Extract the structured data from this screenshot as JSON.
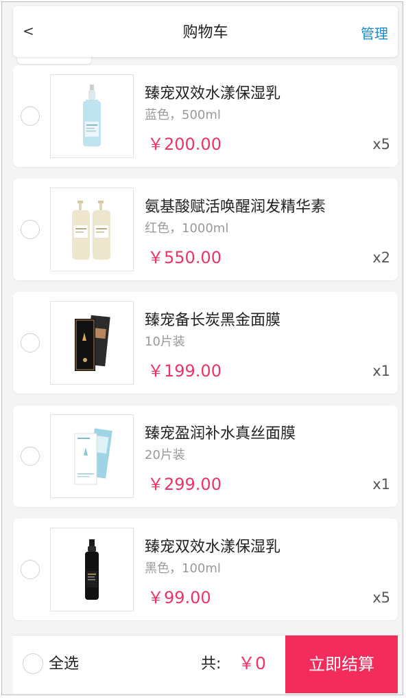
{
  "header": {
    "back_label": "<",
    "title": "购物车",
    "manage_label": "管理"
  },
  "items": [
    {
      "name": "臻宠双效水漾保湿乳",
      "spec": "蓝色，500ml",
      "price": "￥200.00",
      "qty": "x5",
      "image_icon": "blue-lotion-bottle-icon"
    },
    {
      "name": "氨基酸赋活唤醒润发精华素",
      "spec": "红色，1000ml",
      "price": "￥550.00",
      "qty": "x2",
      "image_icon": "pump-bottles-icon"
    },
    {
      "name": "臻宠备长炭黑金面膜",
      "spec": "10片装",
      "price": "￥199.00",
      "qty": "x1",
      "image_icon": "black-gold-mask-box-icon"
    },
    {
      "name": "臻宠盈润补水真丝面膜",
      "spec": "20片装",
      "price": "￥299.00",
      "qty": "x1",
      "image_icon": "silk-mask-box-icon"
    },
    {
      "name": "臻宠双效水漾保湿乳",
      "spec": "黑色，100ml",
      "price": "￥99.00",
      "qty": "x5",
      "image_icon": "black-lotion-bottle-icon"
    }
  ],
  "footer": {
    "select_all_label": "全选",
    "total_label": "共:",
    "total_value": "￥0",
    "checkout_label": "立即结算"
  },
  "colors": {
    "accent_red": "#f03366",
    "checkout_bg": "#f32c5c",
    "link_blue": "#1a8ad1"
  }
}
